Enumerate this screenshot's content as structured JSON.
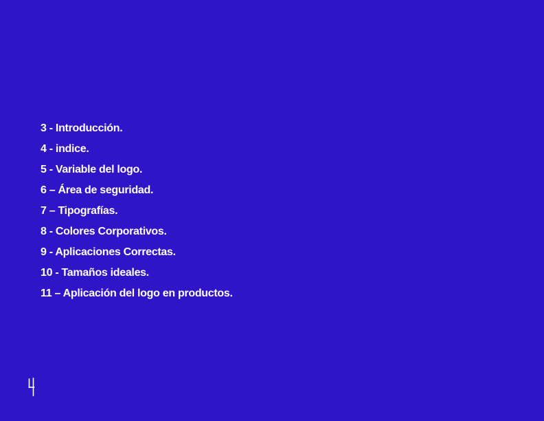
{
  "toc": {
    "items": [
      "3 - Introducción.",
      "4 - indice.",
      "5 - Variable del logo.",
      "6 – Área de seguridad.",
      "7 – Tipografías.",
      "8 - Colores Corporativos.",
      "9 - Aplicaciones Correctas.",
      "10 - Tamaños ideales.",
      "11 – Aplicación del logo en productos."
    ]
  },
  "page_number": "4",
  "colors": {
    "background": "#3014c8",
    "text": "#ffffff"
  }
}
